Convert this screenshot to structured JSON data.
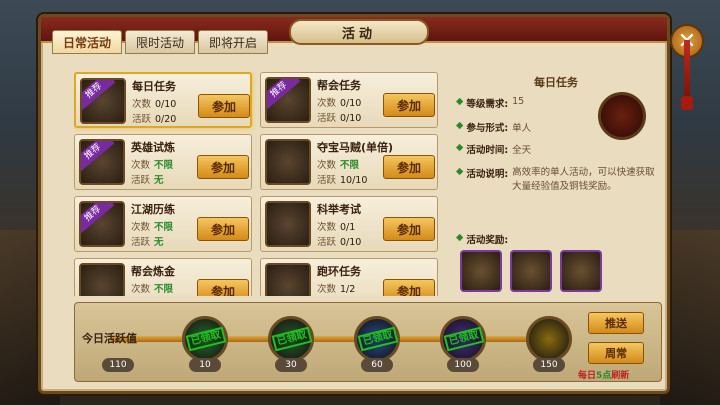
{
  "window": {
    "title": "活动",
    "close": "✕"
  },
  "tabs": [
    {
      "label": "日常活动",
      "active": true
    },
    {
      "label": "限时活动",
      "active": false
    },
    {
      "label": "即将开启",
      "active": false
    }
  ],
  "labels": {
    "count": "次数",
    "active": "活跃",
    "join": "参加",
    "badge": "推荐"
  },
  "activities": [
    {
      "name": "每日任务",
      "count": "0/10",
      "active": "0/20",
      "count_green": false,
      "active_green": false,
      "badge": true,
      "selected": true
    },
    {
      "name": "帮会任务",
      "count": "0/10",
      "active": "0/10",
      "count_green": false,
      "active_green": false,
      "badge": true,
      "selected": false
    },
    {
      "name": "英雄试炼",
      "count": "不限",
      "active": "无",
      "count_green": true,
      "active_green": true,
      "badge": true,
      "selected": false
    },
    {
      "name": "夺宝马贼(单倍)",
      "count": "不限",
      "active": "10/10",
      "count_green": true,
      "active_green": false,
      "badge": false,
      "selected": false
    },
    {
      "name": "江湖历练",
      "count": "不限",
      "active": "无",
      "count_green": true,
      "active_green": true,
      "badge": true,
      "selected": false
    },
    {
      "name": "科举考试",
      "count": "0/1",
      "active": "0/10",
      "count_green": false,
      "active_green": false,
      "badge": false,
      "selected": false
    },
    {
      "name": "帮会炼金",
      "count": "不限",
      "active": "",
      "count_green": true,
      "active_green": false,
      "badge": false,
      "selected": false
    },
    {
      "name": "跑环任务",
      "count": "1/2",
      "active": "",
      "count_green": false,
      "active_green": false,
      "badge": false,
      "selected": false
    }
  ],
  "detail": {
    "title": "每日任务",
    "level_label": "等级需求:",
    "level_value": "15",
    "mode_label": "参与形式:",
    "mode_value": "单人",
    "time_label": "活动时间:",
    "time_value": "全天",
    "desc_label": "活动说明:",
    "desc_value": "高效率的单人活动，可以快速获取大量经验值及铜钱奖励。",
    "reward_label": "活动奖励:"
  },
  "activity_bar": {
    "label": "今日活跃值",
    "current": "110",
    "claimed_text": "已领取",
    "nodes": [
      {
        "value": "10",
        "claimed": true
      },
      {
        "value": "30",
        "claimed": true
      },
      {
        "value": "60",
        "claimed": true
      },
      {
        "value": "100",
        "claimed": true
      },
      {
        "value": "150",
        "claimed": false
      }
    ]
  },
  "buttons": {
    "push": "推送",
    "weekly": "周常"
  },
  "refresh": {
    "prefix": "每日",
    "hour": "5点",
    "suffix": "刷新"
  }
}
